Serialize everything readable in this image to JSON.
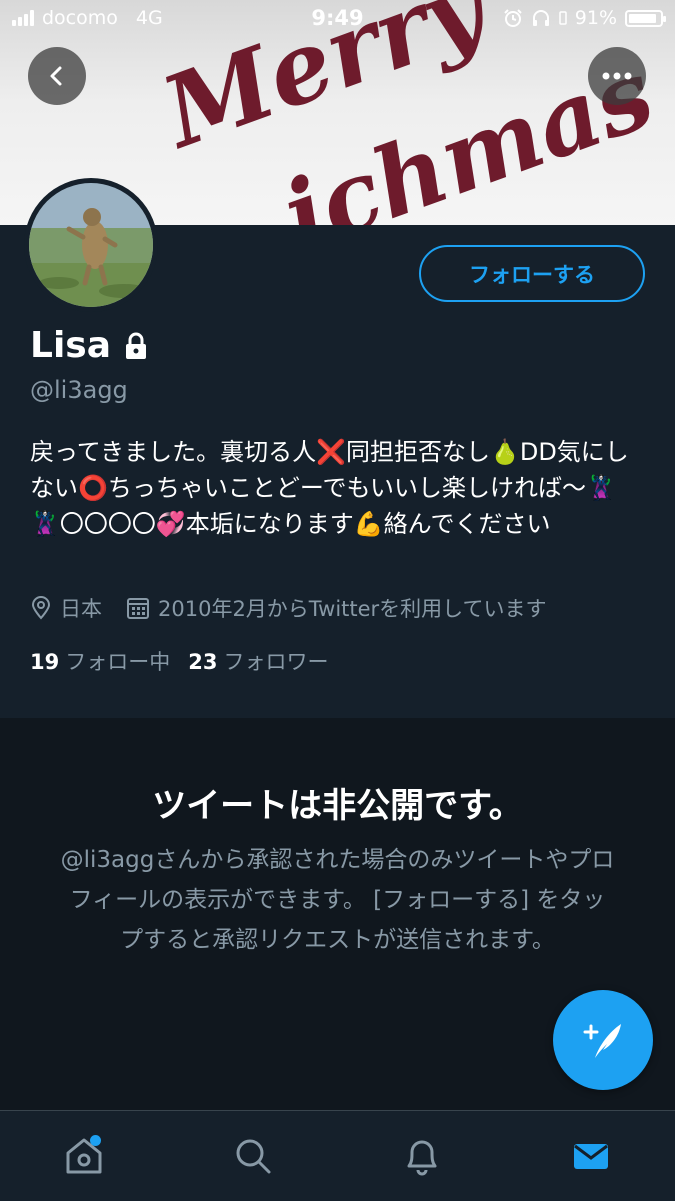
{
  "status_bar": {
    "carrier": "docomo",
    "network": "4G",
    "time": "9:49",
    "battery": "91%",
    "battery_level": 0.91
  },
  "banner": {
    "text_line1": "Merry",
    "text_line2": "ichmas",
    "text_color": "#6e1b2c"
  },
  "icons": {
    "back": "back-arrow-icon",
    "more": "more-dots-icon",
    "lock": "lock-icon",
    "location": "location-pin-icon",
    "calendar": "calendar-icon",
    "compose": "compose-quill-icon",
    "home": "home-icon",
    "search": "search-icon",
    "notifications": "bell-icon",
    "messages": "mail-icon"
  },
  "profile": {
    "name": "Lisa",
    "handle": "@li3agg",
    "follow_label": "フォローする",
    "bio": "戻ってきました。裏切る人❌同担拒否なし🍐DD気にしない⭕ちっちゃいことどーでもいいし楽しければ〜🦹‍♀️🦹‍♀️〇〇〇〇💞本垢になります💪絡んでください",
    "location": "日本",
    "joined": "2010年2月からTwitterを利用しています",
    "following_count": "19",
    "following_label": "フォロー中",
    "followers_count": "23",
    "followers_label": "フォロワー"
  },
  "private_notice": {
    "title": "ツイートは非公開です。",
    "description": "@li3aggさんから承認された場合のみツイートやプロフィールの表示ができます。 [フォローする] をタップすると承認リクエストが送信されます。"
  },
  "colors": {
    "background": "#15202b",
    "accent": "#1da1f2",
    "secondary_text": "#8899a6"
  }
}
